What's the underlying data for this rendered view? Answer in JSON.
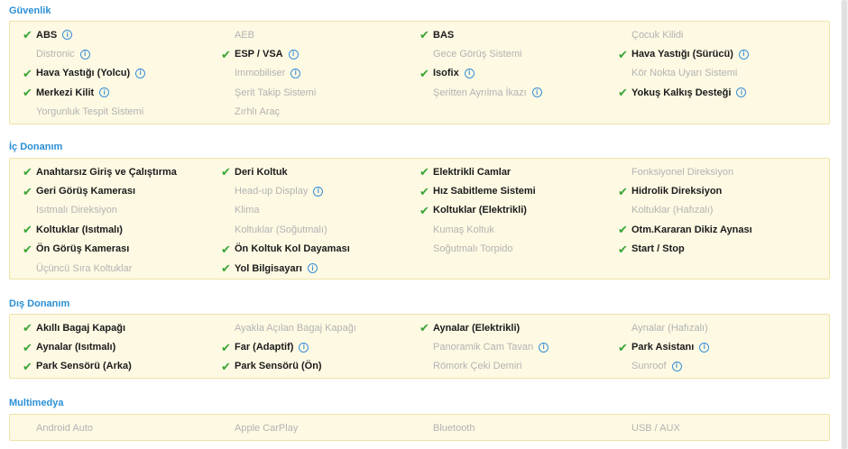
{
  "sections": [
    {
      "title": "Güvenlik",
      "items": [
        {
          "label": "ABS",
          "active": true,
          "info": true
        },
        {
          "label": "AEB",
          "active": false,
          "info": false
        },
        {
          "label": "BAS",
          "active": true,
          "info": false
        },
        {
          "label": "Çocuk Kilidi",
          "active": false,
          "info": false
        },
        {
          "label": "Distronic",
          "active": false,
          "info": true
        },
        {
          "label": "ESP / VSA",
          "active": true,
          "info": true
        },
        {
          "label": "Gece Görüş Sistemi",
          "active": false,
          "info": false
        },
        {
          "label": "Hava Yastığı (Sürücü)",
          "active": true,
          "info": true
        },
        {
          "label": "Hava Yastığı (Yolcu)",
          "active": true,
          "info": true
        },
        {
          "label": "Immobiliser",
          "active": false,
          "info": true
        },
        {
          "label": "Isofix",
          "active": true,
          "info": true
        },
        {
          "label": "Kör Nokta Uyarı Sistemi",
          "active": false,
          "info": false
        },
        {
          "label": "Merkezi Kilit",
          "active": true,
          "info": true
        },
        {
          "label": "Şerit Takip Sistemi",
          "active": false,
          "info": false
        },
        {
          "label": "Şeritten Ayrılma İkazı",
          "active": false,
          "info": true
        },
        {
          "label": "Yokuş Kalkış Desteği",
          "active": true,
          "info": true
        },
        {
          "label": "Yorgunluk Tespit Sistemi",
          "active": false,
          "info": false
        },
        {
          "label": "Zırhlı Araç",
          "active": false,
          "info": false
        }
      ]
    },
    {
      "title": "İç Donanım",
      "items": [
        {
          "label": "Anahtarsız Giriş ve Çalıştırma",
          "active": true,
          "info": false
        },
        {
          "label": "Deri Koltuk",
          "active": true,
          "info": false
        },
        {
          "label": "Elektrikli Camlar",
          "active": true,
          "info": false
        },
        {
          "label": "Fonksiyonel Direksiyon",
          "active": false,
          "info": false
        },
        {
          "label": "Geri Görüş Kamerası",
          "active": true,
          "info": false
        },
        {
          "label": "Head-up Display",
          "active": false,
          "info": true
        },
        {
          "label": "Hız Sabitleme Sistemi",
          "active": true,
          "info": false
        },
        {
          "label": "Hidrolik Direksiyon",
          "active": true,
          "info": false
        },
        {
          "label": "Isıtmalı Direksiyon",
          "active": false,
          "info": false
        },
        {
          "label": "Klima",
          "active": false,
          "info": false
        },
        {
          "label": "Koltuklar (Elektrikli)",
          "active": true,
          "info": false
        },
        {
          "label": "Koltuklar (Hafızalı)",
          "active": false,
          "info": false
        },
        {
          "label": "Koltuklar (Isıtmalı)",
          "active": true,
          "info": false
        },
        {
          "label": "Koltuklar (Soğutmalı)",
          "active": false,
          "info": false
        },
        {
          "label": "Kumaş Koltuk",
          "active": false,
          "info": false
        },
        {
          "label": "Otm.Kararan Dikiz Aynası",
          "active": true,
          "info": false
        },
        {
          "label": "Ön Görüş Kamerası",
          "active": true,
          "info": false
        },
        {
          "label": "Ön Koltuk Kol Dayaması",
          "active": true,
          "info": false
        },
        {
          "label": "Soğutmalı Torpido",
          "active": false,
          "info": false
        },
        {
          "label": "Start / Stop",
          "active": true,
          "info": false
        },
        {
          "label": "Üçüncü Sıra Koltuklar",
          "active": false,
          "info": false
        },
        {
          "label": "Yol Bilgisayarı",
          "active": true,
          "info": true
        }
      ]
    },
    {
      "title": "Dış Donanım",
      "items": [
        {
          "label": "Akıllı Bagaj Kapağı",
          "active": true,
          "info": false
        },
        {
          "label": "Ayakla Açılan Bagaj Kapağı",
          "active": false,
          "info": false
        },
        {
          "label": "Aynalar (Elektrikli)",
          "active": true,
          "info": false
        },
        {
          "label": "Aynalar (Hafızalı)",
          "active": false,
          "info": false
        },
        {
          "label": "Aynalar (Isıtmalı)",
          "active": true,
          "info": false
        },
        {
          "label": "Far (Adaptif)",
          "active": true,
          "info": true
        },
        {
          "label": "Panoramik Cam Tavan",
          "active": false,
          "info": true
        },
        {
          "label": "Park Asistanı",
          "active": true,
          "info": true
        },
        {
          "label": "Park Sensörü (Arka)",
          "active": true,
          "info": false
        },
        {
          "label": "Park Sensörü (Ön)",
          "active": true,
          "info": false
        },
        {
          "label": "Römork Çeki Demiri",
          "active": false,
          "info": false
        },
        {
          "label": "Sunroof",
          "active": false,
          "info": true
        }
      ]
    },
    {
      "title": "Multimedya",
      "items": [
        {
          "label": "Android Auto",
          "active": false,
          "info": false
        },
        {
          "label": "Apple CarPlay",
          "active": false,
          "info": false
        },
        {
          "label": "Bluetooth",
          "active": false,
          "info": false
        },
        {
          "label": "USB / AUX",
          "active": false,
          "info": false
        }
      ]
    }
  ],
  "icons": {
    "check": "check-icon",
    "info": "info-icon"
  },
  "colors": {
    "section_title": "#2a8fd4",
    "box_background": "#fdf9e3",
    "box_border": "#efe3a8",
    "check": "#3aa537",
    "info": "#3a8fd8",
    "active_text": "#1b1b1b",
    "inactive_text": "#b3b3b3"
  }
}
